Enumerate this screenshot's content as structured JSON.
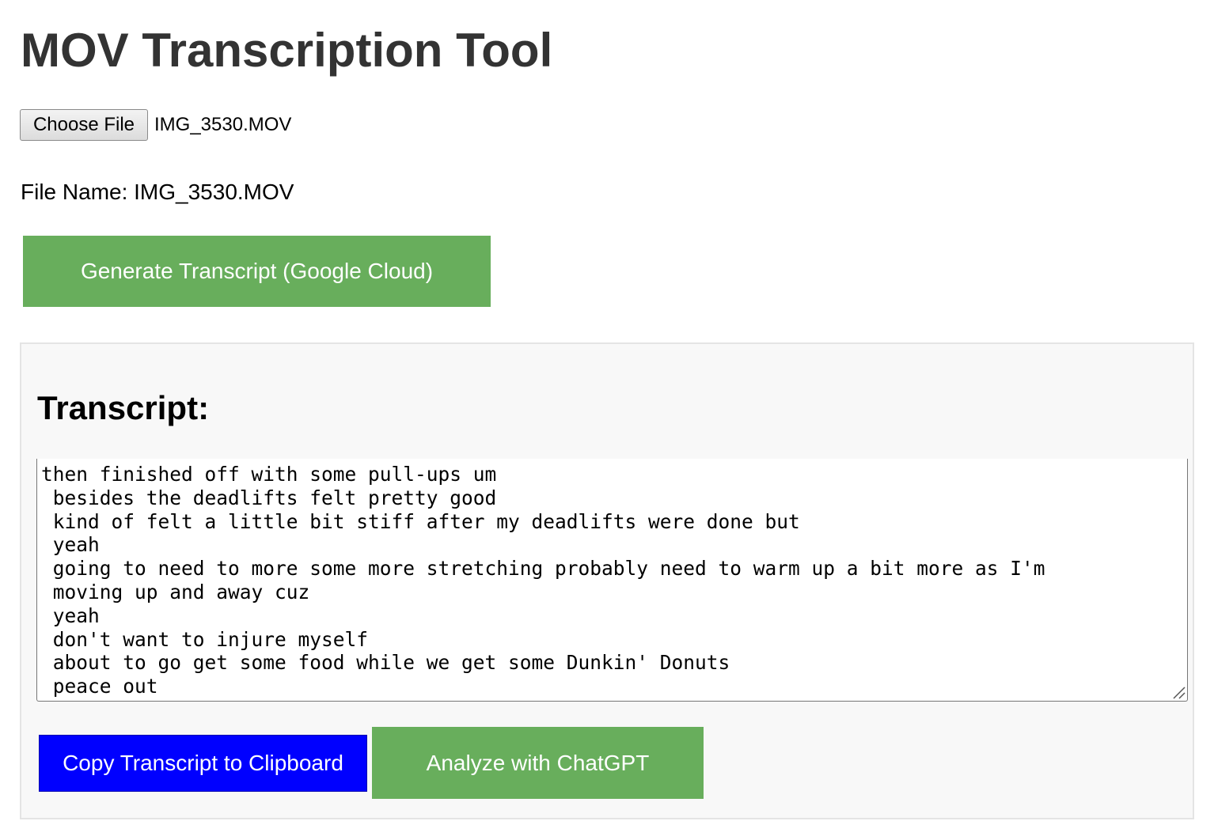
{
  "page": {
    "title": "MOV Transcription Tool"
  },
  "file_input": {
    "button_label": "Choose File",
    "selected_file": "IMG_3530.MOV"
  },
  "file_info": {
    "line": "File Name: IMG_3530.MOV"
  },
  "actions": {
    "generate_label": "Generate Transcript (Google Cloud)",
    "copy_label": "Copy Transcript to Clipboard",
    "analyze_label": "Analyze with ChatGPT"
  },
  "transcript": {
    "heading": "Transcript:",
    "text": "then finished off with some pull-ups um\n besides the deadlifts felt pretty good\n kind of felt a little bit stiff after my deadlifts were done but\n yeah\n going to need to more some more stretching probably need to warm up a bit more as I'm\n moving up and away cuz\n yeah\n don't want to injure myself\n about to go get some food while we get some Dunkin' Donuts\n peace out"
  },
  "colors": {
    "title_text": "#333333",
    "green_button": "#68ae5c",
    "blue_button": "#0000ff",
    "panel_background": "#f8f8f8"
  }
}
